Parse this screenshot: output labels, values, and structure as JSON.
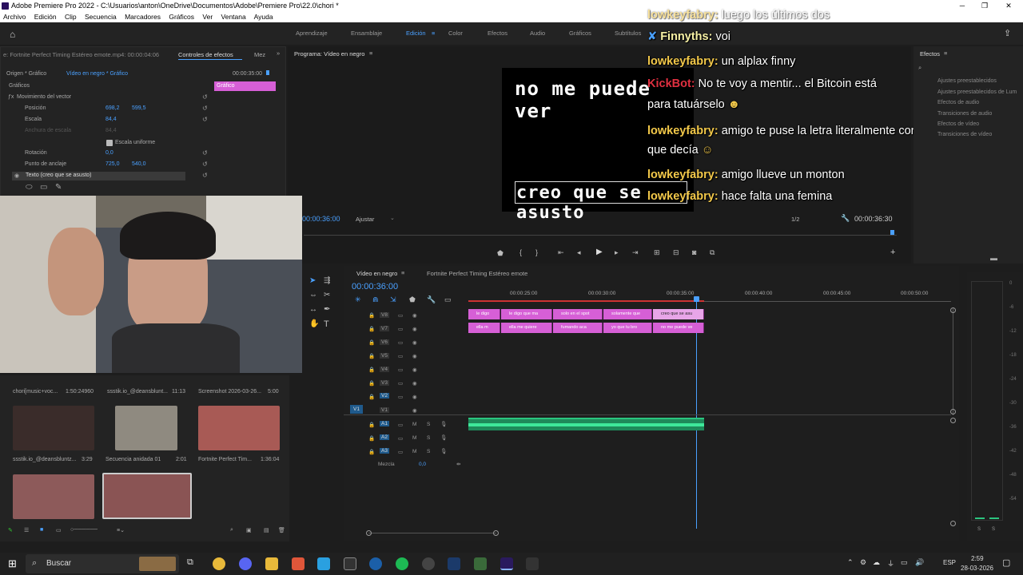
{
  "window": {
    "title": "Adobe Premiere Pro 2022 - C:\\Usuarios\\anton\\OneDrive\\Documentos\\Adobe\\Premiere Pro\\22.0\\chori *"
  },
  "menu": [
    "Archivo",
    "Edición",
    "Clip",
    "Secuencia",
    "Marcadores",
    "Gráficos",
    "Ver",
    "Ventana",
    "Ayuda"
  ],
  "workspaces": [
    "Aprendizaje",
    "Ensamblaje",
    "Edición",
    "Color",
    "Efectos",
    "Audio",
    "Gráficos",
    "Subtítulos"
  ],
  "effect_controls": {
    "source_label": "e: Fortnite Perfect Timing Estéreo emote.mp4: 00:00:04:06",
    "tab": "Controles de efectos",
    "tab2": "Mez",
    "origin": "Origen * Gráfico",
    "target": "Vídeo en negro * Gráfico",
    "section": "Gráficos",
    "clip_label": "Gráfico",
    "timecode": "00:00:35:00",
    "rows": [
      {
        "label": "Movimiento del vector"
      },
      {
        "label": "Posición",
        "v1": "698,2",
        "v2": "599,5"
      },
      {
        "label": "Escala",
        "v1": "84,4"
      },
      {
        "label": "Anchura de escala",
        "v1": "84,4"
      },
      {
        "label": "Escala uniforme"
      },
      {
        "label": "Rotación",
        "v1": "0,0"
      },
      {
        "label": "Punto de anclaje",
        "v1": "725,0",
        "v2": "540,0"
      },
      {
        "label": "Texto (creo que se asusto)"
      }
    ]
  },
  "program": {
    "title": "Programa: Vídeo en negro",
    "timecode_left": "00:00:36:00",
    "fit": "Ajustar",
    "res": "1/2",
    "timecode_right": "00:00:36:30",
    "text_top": "no me puede ver",
    "text_bottom": "creo que se asusto"
  },
  "chat": [
    {
      "user": "lowkeyfabry:",
      "text": "luego los últimos dos"
    },
    {
      "user": "Finnyths:",
      "text": "voi"
    },
    {
      "user": "lowkeyfabry:",
      "text": "un alplax finny"
    },
    {
      "user": "KickBot:",
      "text": "No te voy a mentir... el Bitcoin está"
    },
    {
      "user": "",
      "text": "para tatuárselo"
    },
    {
      "user": "lowkeyfabry:",
      "text": "amigo te puse la letra literalmente con lo"
    },
    {
      "user": "",
      "text": "que decía"
    },
    {
      "user": "lowkeyfabry:",
      "text": "amigo llueve un monton"
    },
    {
      "user": "lowkeyfabry:",
      "text": "hace falta una femina"
    }
  ],
  "effects_panel": {
    "title": "Efectos",
    "items": [
      "Ajustes preestablecidos",
      "Ajustes preestablecidos de Lum",
      "Efectos de audio",
      "Transiciones de audio",
      "Efectos de vídeo",
      "Transiciones de vídeo"
    ]
  },
  "timeline": {
    "tab1": "Vídeo en negro",
    "tab2": "Fortnite Perfect Timing Estéreo emote",
    "timecode": "00:00:36:00",
    "ruler": [
      "00:00:25:00",
      "00:00:30:00",
      "00:00:35:00",
      "00:00:40:00",
      "00:00:45:00",
      "00:00:50:00"
    ],
    "video_tracks": [
      "V8",
      "V7",
      "V6",
      "V5",
      "V4",
      "V3",
      "V2",
      "V1"
    ],
    "audio_tracks": [
      "A1",
      "A2",
      "A3"
    ],
    "mix_label": "Mezcla",
    "mix_value": "0,0",
    "v8_clips": [
      "le digo",
      "le digo que ma",
      "solo en el spot",
      "solamente que",
      "creo que se asu"
    ],
    "v7_clips": [
      "ella m",
      "ella me quiere",
      "fumando aca",
      "yo que tu bro",
      "no me puede ve"
    ]
  },
  "project": {
    "items": [
      {
        "name": "chori[music+voc...",
        "dur": "1:50:24960"
      },
      {
        "name": "ssstik.io_@deansblunt...",
        "dur": "11:13"
      },
      {
        "name": "Screenshot 2026-03-26...",
        "dur": "5:00"
      },
      {
        "name": "ssstik.io_@deansbluntz...",
        "dur": "3:29"
      },
      {
        "name": "Secuencia anidada 01",
        "dur": "2:01"
      },
      {
        "name": "Fortnite Perfect Tim...",
        "dur": "1:36:04"
      }
    ]
  },
  "taskbar": {
    "search": "Buscar",
    "lang": "ESP",
    "time": "2:59",
    "date": "28-03-2026"
  },
  "meter_labels": [
    "S",
    "S"
  ],
  "db_labels": [
    "0",
    "-6",
    "-12",
    "-18",
    "-24",
    "-30",
    "-36",
    "-42",
    "-48",
    "-54"
  ]
}
